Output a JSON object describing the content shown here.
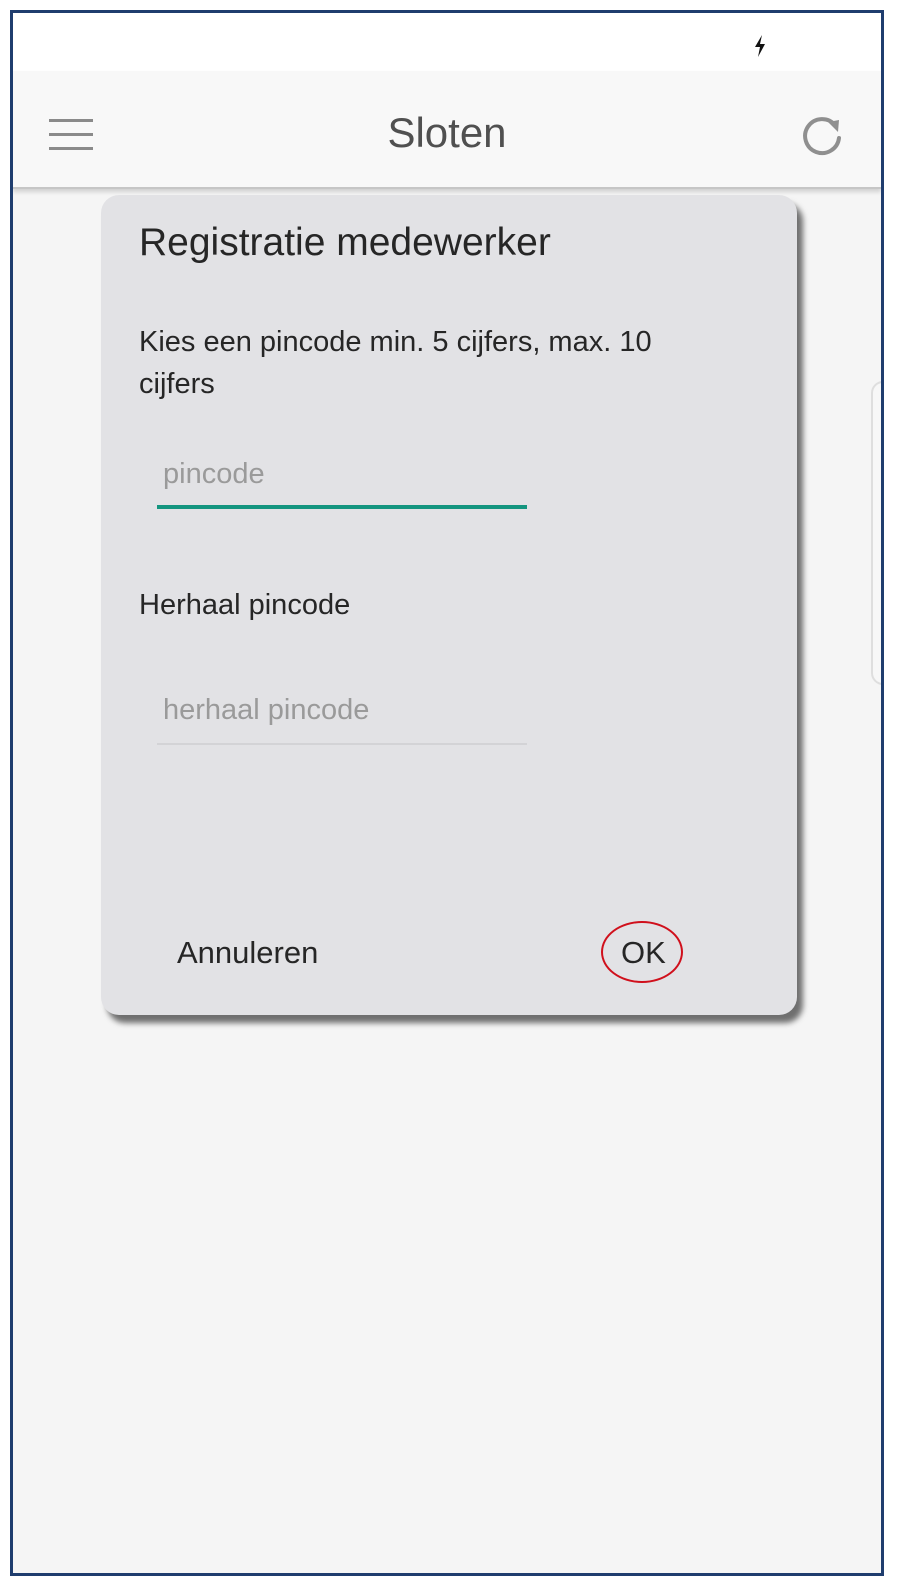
{
  "statusbar": {
    "icon": "charging-bolt-icon"
  },
  "appbar": {
    "title": "Sloten",
    "menu_icon": "hamburger-menu-icon",
    "refresh_icon": "refresh-icon"
  },
  "dialog": {
    "title": "Registratie medewerker",
    "message": "Kies een pincode min. 5 cijfers, max. 10 cijfers",
    "pin_field": {
      "placeholder": "pincode",
      "value": ""
    },
    "repeat_label": "Herhaal pincode",
    "repeat_field": {
      "placeholder": "herhaal pincode",
      "value": ""
    },
    "cancel_label": "Annuleren",
    "ok_label": "OK"
  },
  "colors": {
    "frame_border": "#1f3d6e",
    "dialog_background": "#e2e2e5",
    "active_underline": "#14957f",
    "annotation_circle": "#d0101c"
  }
}
